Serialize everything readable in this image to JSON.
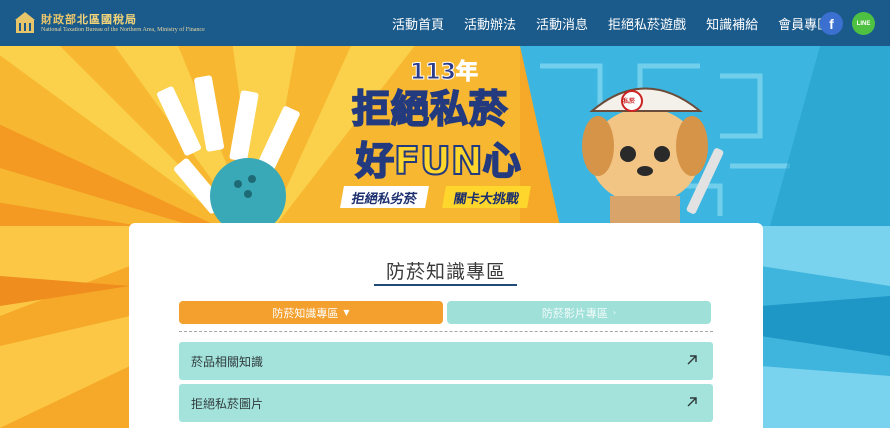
{
  "header": {
    "logo_title_a": "財政部",
    "logo_title_b": "北區國稅局",
    "logo_subtitle": "National Taxation Bureau of the Northern Area, Ministry of Finance",
    "nav": [
      {
        "label": "活動首頁"
      },
      {
        "label": "活動辦法"
      },
      {
        "label": "活動消息"
      },
      {
        "label": "拒絕私菸遊戲"
      },
      {
        "label": "知識補給"
      },
      {
        "label": "會員專區"
      }
    ],
    "social": {
      "facebook_icon": "f",
      "line_icon": "LINE"
    }
  },
  "banner": {
    "year": "113年",
    "title_line1": "拒絕私菸",
    "title_line2": "好FUN心",
    "tag1": "拒絕私劣菸",
    "tag2": "關卡大挑戰",
    "mascot_badge": "私菸"
  },
  "content": {
    "page_title": "防菸知識專區",
    "tabs": [
      {
        "label": "防菸知識專區",
        "icon": "caret-down-icon",
        "active": true
      },
      {
        "label": "防菸影片專區",
        "icon": "chevron-right-icon",
        "active": false
      }
    ],
    "items": [
      {
        "label": "菸品相關知識",
        "icon": "external-arrow-icon"
      },
      {
        "label": "拒絕私菸圖片",
        "icon": "external-arrow-icon"
      }
    ]
  },
  "colors": {
    "header_bg": "#1b5b8c",
    "tab_active": "#f3a02e",
    "tab_inactive": "#9fe0d9",
    "list_bg": "#a4e3dc",
    "title_underline": "#1f4a79"
  }
}
